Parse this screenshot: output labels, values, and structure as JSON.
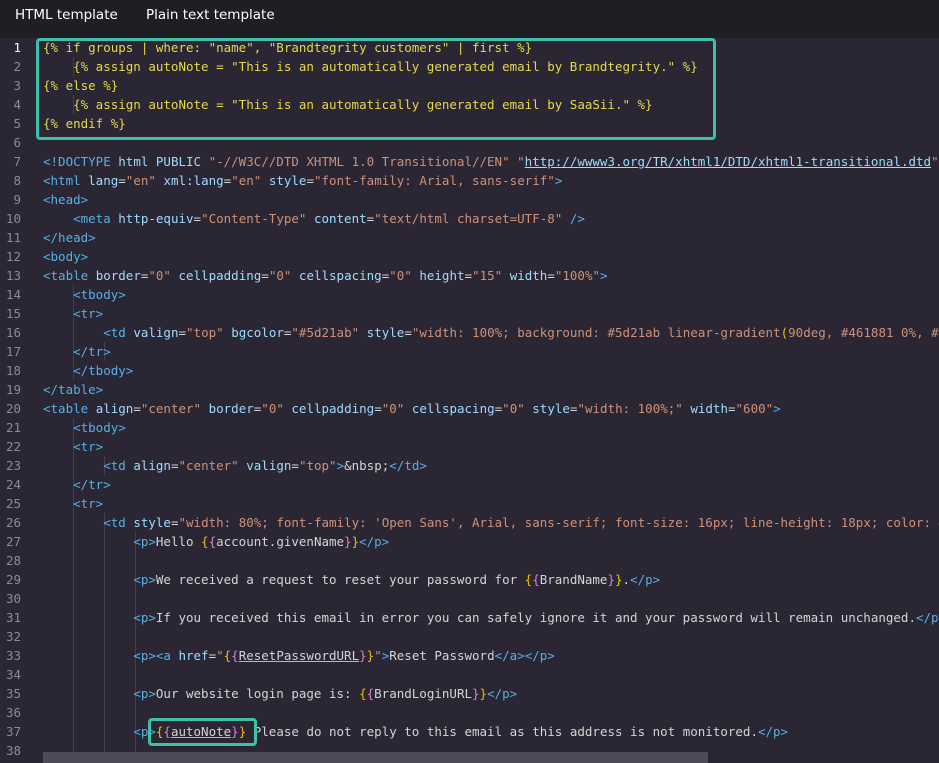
{
  "tabs": [
    {
      "label": "HTML template"
    },
    {
      "label": "Plain text template"
    }
  ],
  "editor": {
    "line_numbers": [
      "1",
      "2",
      "3",
      "4",
      "5",
      "6",
      "7",
      "8",
      "9",
      "10",
      "11",
      "12",
      "13",
      "14",
      "15",
      "16",
      "17",
      "18",
      "19",
      "20",
      "21",
      "22",
      "23",
      "24",
      "25",
      "26",
      "27",
      "28",
      "29",
      "30",
      "31",
      "32",
      "33",
      "34",
      "35",
      "36",
      "37",
      "38"
    ],
    "lines": [
      [
        [
          "liq",
          "{% if groups | where: \"name\", \"Brandtegrity customers\" | first %}"
        ]
      ],
      [
        [
          "liq",
          "    {% assign autoNote = \"This is an automatically generated email by Brandtegrity.\" %}"
        ]
      ],
      [
        [
          "liq",
          "{% else %}"
        ]
      ],
      [
        [
          "liq",
          "    {% assign autoNote = \"This is an automatically generated email by SaaSii.\" %}"
        ]
      ],
      [
        [
          "liq",
          "{% endif %}"
        ]
      ],
      [],
      [
        [
          "tag",
          "<!DOCTYPE "
        ],
        [
          "attr",
          "html PUBLIC "
        ],
        [
          "str",
          "\"-//W3C//DTD XHTML 1.0 Transitional//EN\""
        ],
        [
          "txt",
          " "
        ],
        [
          "str",
          "\""
        ],
        [
          "url",
          "http://wwww3.org/TR/xhtml1/DTD/xhtml1-transitional.dtd"
        ],
        [
          "str",
          "\">"
        ]
      ],
      [
        [
          "tag",
          "<html "
        ],
        [
          "attr",
          "lang"
        ],
        [
          "txt",
          "="
        ],
        [
          "str",
          "\"en\""
        ],
        [
          "txt",
          " "
        ],
        [
          "attr",
          "xml:lang"
        ],
        [
          "txt",
          "="
        ],
        [
          "str",
          "\"en\""
        ],
        [
          "txt",
          " "
        ],
        [
          "attr",
          "style"
        ],
        [
          "txt",
          "="
        ],
        [
          "str",
          "\"font-family: Arial, sans-serif\""
        ],
        [
          "tag",
          ">"
        ]
      ],
      [
        [
          "tag",
          "<head>"
        ]
      ],
      [
        [
          "txt",
          "    "
        ],
        [
          "tag",
          "<meta "
        ],
        [
          "attr",
          "http-equiv"
        ],
        [
          "txt",
          "="
        ],
        [
          "str",
          "\"Content-Type\""
        ],
        [
          "txt",
          " "
        ],
        [
          "attr",
          "content"
        ],
        [
          "txt",
          "="
        ],
        [
          "str",
          "\"text/html charset=UTF-8\""
        ],
        [
          "tag",
          " />"
        ]
      ],
      [
        [
          "tag",
          "</head>"
        ]
      ],
      [
        [
          "tag",
          "<body>"
        ]
      ],
      [
        [
          "tag",
          "<table "
        ],
        [
          "attr",
          "border"
        ],
        [
          "txt",
          "="
        ],
        [
          "str",
          "\"0\""
        ],
        [
          "txt",
          " "
        ],
        [
          "attr",
          "cellpadding"
        ],
        [
          "txt",
          "="
        ],
        [
          "str",
          "\"0\""
        ],
        [
          "txt",
          " "
        ],
        [
          "attr",
          "cellspacing"
        ],
        [
          "txt",
          "="
        ],
        [
          "str",
          "\"0\""
        ],
        [
          "txt",
          " "
        ],
        [
          "attr",
          "height"
        ],
        [
          "txt",
          "="
        ],
        [
          "str",
          "\"15\""
        ],
        [
          "txt",
          " "
        ],
        [
          "attr",
          "width"
        ],
        [
          "txt",
          "="
        ],
        [
          "str",
          "\"100%\""
        ],
        [
          "tag",
          ">"
        ]
      ],
      [
        [
          "txt",
          "    "
        ],
        [
          "tag",
          "<tbody>"
        ]
      ],
      [
        [
          "txt",
          "    "
        ],
        [
          "tag",
          "<tr>"
        ]
      ],
      [
        [
          "txt",
          "        "
        ],
        [
          "tag",
          "<td "
        ],
        [
          "attr",
          "valign"
        ],
        [
          "txt",
          "="
        ],
        [
          "str",
          "\"top\""
        ],
        [
          "txt",
          " "
        ],
        [
          "attr",
          "bgcolor"
        ],
        [
          "txt",
          "="
        ],
        [
          "str",
          "\"#5d21ab\""
        ],
        [
          "txt",
          " "
        ],
        [
          "attr",
          "style"
        ],
        [
          "txt",
          "="
        ],
        [
          "str",
          "\"width: 100%; background: #5d21ab linear-gradient"
        ],
        [
          "br1",
          "("
        ],
        [
          "str",
          "90deg, #461881 0%, #5d21ab 100%"
        ],
        [
          "br1",
          ")"
        ],
        [
          "str",
          ";\""
        ],
        [
          "tag",
          "></td>"
        ]
      ],
      [
        [
          "txt",
          "    "
        ],
        [
          "tag",
          "</tr>"
        ]
      ],
      [
        [
          "txt",
          "    "
        ],
        [
          "tag",
          "</tbody>"
        ]
      ],
      [
        [
          "tag",
          "</table>"
        ]
      ],
      [
        [
          "tag",
          "<table "
        ],
        [
          "attr",
          "align"
        ],
        [
          "txt",
          "="
        ],
        [
          "str",
          "\"center\""
        ],
        [
          "txt",
          " "
        ],
        [
          "attr",
          "border"
        ],
        [
          "txt",
          "="
        ],
        [
          "str",
          "\"0\""
        ],
        [
          "txt",
          " "
        ],
        [
          "attr",
          "cellpadding"
        ],
        [
          "txt",
          "="
        ],
        [
          "str",
          "\"0\""
        ],
        [
          "txt",
          " "
        ],
        [
          "attr",
          "cellspacing"
        ],
        [
          "txt",
          "="
        ],
        [
          "str",
          "\"0\""
        ],
        [
          "txt",
          " "
        ],
        [
          "attr",
          "style"
        ],
        [
          "txt",
          "="
        ],
        [
          "str",
          "\"width: 100%;\""
        ],
        [
          "txt",
          " "
        ],
        [
          "attr",
          "width"
        ],
        [
          "txt",
          "="
        ],
        [
          "str",
          "\"600\""
        ],
        [
          "tag",
          ">"
        ]
      ],
      [
        [
          "txt",
          "    "
        ],
        [
          "tag",
          "<tbody>"
        ]
      ],
      [
        [
          "txt",
          "    "
        ],
        [
          "tag",
          "<tr>"
        ]
      ],
      [
        [
          "txt",
          "        "
        ],
        [
          "tag",
          "<td "
        ],
        [
          "attr",
          "align"
        ],
        [
          "txt",
          "="
        ],
        [
          "str",
          "\"center\""
        ],
        [
          "txt",
          " "
        ],
        [
          "attr",
          "valign"
        ],
        [
          "txt",
          "="
        ],
        [
          "str",
          "\"top\""
        ],
        [
          "tag",
          ">"
        ],
        [
          "txt",
          "&nbsp;"
        ],
        [
          "tag",
          "</td>"
        ]
      ],
      [
        [
          "txt",
          "    "
        ],
        [
          "tag",
          "</tr>"
        ]
      ],
      [
        [
          "txt",
          "    "
        ],
        [
          "tag",
          "<tr>"
        ]
      ],
      [
        [
          "txt",
          "        "
        ],
        [
          "tag",
          "<td "
        ],
        [
          "attr",
          "style"
        ],
        [
          "txt",
          "="
        ],
        [
          "str",
          "\"width: 80%; font-family: 'Open Sans', Arial, sans-serif; font-size: 16px; line-height: 18px; color: #333333;\""
        ],
        [
          "tag",
          ">"
        ]
      ],
      [
        [
          "txt",
          "            "
        ],
        [
          "tag",
          "<p>"
        ],
        [
          "txt",
          "Hello "
        ],
        [
          "br1",
          "{"
        ],
        [
          "br2",
          "{"
        ],
        [
          "var2",
          "account.givenName"
        ],
        [
          "br2",
          "}"
        ],
        [
          "br1",
          "}"
        ],
        [
          "tag",
          "</p>"
        ]
      ],
      [],
      [
        [
          "txt",
          "            "
        ],
        [
          "tag",
          "<p>"
        ],
        [
          "txt",
          "We received a request to reset your password for "
        ],
        [
          "br1",
          "{"
        ],
        [
          "br2",
          "{"
        ],
        [
          "var2",
          "BrandName"
        ],
        [
          "br2",
          "}"
        ],
        [
          "br1",
          "}"
        ],
        [
          "txt",
          "."
        ],
        [
          "tag",
          "</p>"
        ]
      ],
      [],
      [
        [
          "txt",
          "            "
        ],
        [
          "tag",
          "<p>"
        ],
        [
          "txt",
          "If you received this email in error you can safely ignore it and your password will remain unchanged."
        ],
        [
          "tag",
          "</p>"
        ]
      ],
      [],
      [
        [
          "txt",
          "            "
        ],
        [
          "tag",
          "<p><a "
        ],
        [
          "attr",
          "href"
        ],
        [
          "txt",
          "="
        ],
        [
          "str",
          "\""
        ],
        [
          "br1",
          "{"
        ],
        [
          "br2",
          "{"
        ],
        [
          "var",
          "ResetPasswordURL"
        ],
        [
          "br2",
          "}"
        ],
        [
          "br1",
          "}"
        ],
        [
          "str",
          "\""
        ],
        [
          "tag",
          ">"
        ],
        [
          "txt",
          "Reset Password"
        ],
        [
          "tag",
          "</a></p>"
        ]
      ],
      [],
      [
        [
          "txt",
          "            "
        ],
        [
          "tag",
          "<p>"
        ],
        [
          "txt",
          "Our website login page is: "
        ],
        [
          "br1",
          "{"
        ],
        [
          "br2",
          "{"
        ],
        [
          "var2",
          "BrandLoginURL"
        ],
        [
          "br2",
          "}"
        ],
        [
          "br1",
          "}"
        ],
        [
          "tag",
          "</p>"
        ]
      ],
      [],
      [
        [
          "txt",
          "            "
        ],
        [
          "tag",
          "<p>"
        ],
        [
          "br1",
          "{"
        ],
        [
          "br2",
          "{"
        ],
        [
          "var",
          "autoNote"
        ],
        [
          "br2",
          "}"
        ],
        [
          "br1",
          "}"
        ],
        [
          "txt",
          " Please do not reply to this email as this address is not monitored."
        ],
        [
          "tag",
          "</p>"
        ]
      ],
      []
    ]
  }
}
